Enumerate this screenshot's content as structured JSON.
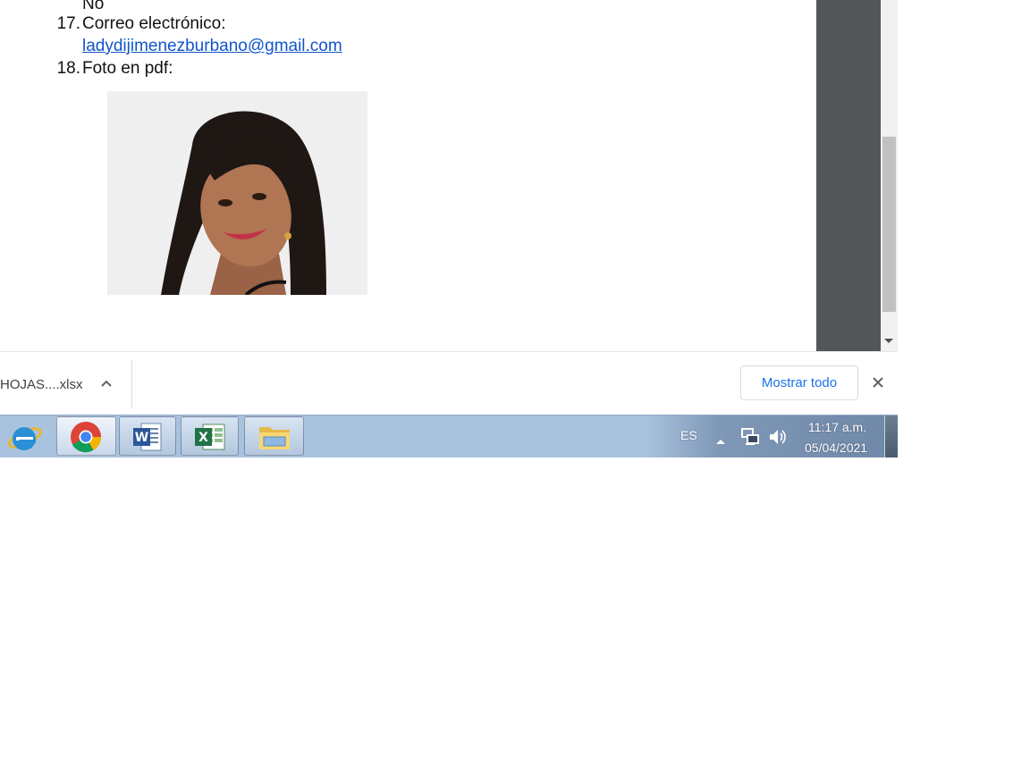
{
  "document": {
    "prev_answer": "No",
    "items": [
      {
        "number": "17.",
        "label": "Correo electrónico:",
        "link": "ladydijimenezburbano@gmail.com"
      },
      {
        "number": "18.",
        "label": "Foto en pdf:"
      }
    ]
  },
  "download_bar": {
    "file_name": "HOJAS....xlsx",
    "show_all_label": "Mostrar todo"
  },
  "taskbar": {
    "apps": [
      "internet-explorer-icon",
      "chrome-icon",
      "word-icon",
      "excel-icon",
      "file-explorer-icon"
    ],
    "tray": {
      "language": "ES",
      "time": "11:17 a.m.",
      "date": "05/04/2021"
    }
  },
  "colors": {
    "viewer_background": "#525659",
    "link": "#1155cc",
    "accent_button_text": "#1a73e8",
    "taskbar": "#a9c3df"
  }
}
